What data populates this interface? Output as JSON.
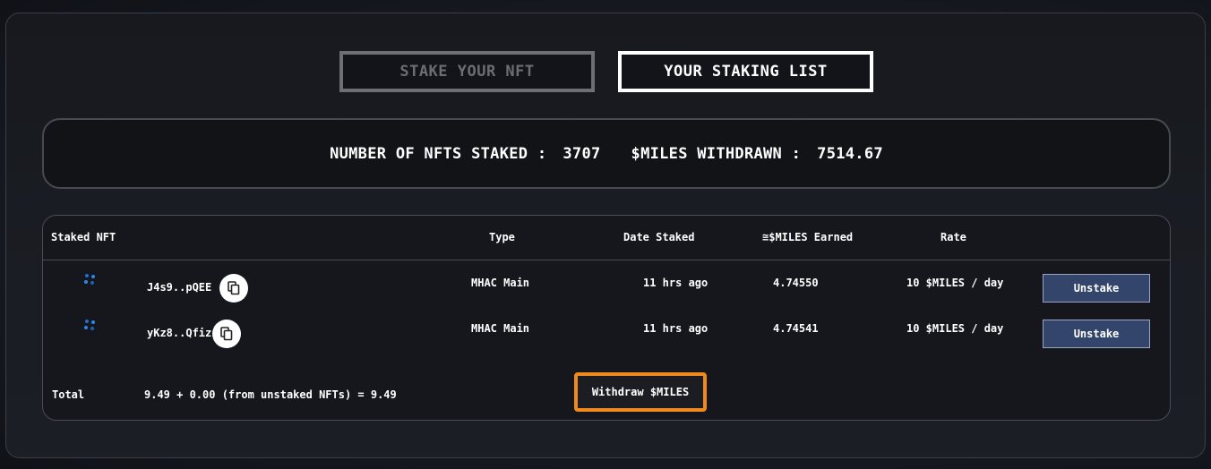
{
  "tabs": {
    "stake_label": "STAKE YOUR NFT",
    "list_label": "YOUR STAKING LIST"
  },
  "stats": {
    "nfts_staked_label": "NUMBER OF NFTS STAKED :",
    "nfts_staked_value": "3707",
    "withdrawn_label": "$MILES WITHDRAWN :",
    "withdrawn_value": "7514.67"
  },
  "table": {
    "headers": {
      "nft": "Staked NFT",
      "type": "Type",
      "date": "Date Staked",
      "earned": "≅$MILES Earned",
      "rate": "Rate"
    },
    "rows": [
      {
        "nft_id": "J4s9..pQEE",
        "type": "MHAC Main",
        "date": "11 hrs ago",
        "earned": "4.74550",
        "rate": "10 $MILES / day",
        "action": "Unstake"
      },
      {
        "nft_id": "yKz8..Qfiz",
        "type": "MHAC Main",
        "date": "11 hrs ago",
        "earned": "4.74541",
        "rate": "10 $MILES / day",
        "action": "Unstake"
      }
    ],
    "total_label": "Total",
    "total_value": "9.49 + 0.00 (from unstaked NFTs) = 9.49",
    "withdraw_label": "Withdraw $MILES"
  },
  "colors": {
    "accent_orange": "#f08a1c",
    "unstake_blue": "#34456b",
    "nft_icon_blue": "#1f6fd6"
  },
  "icons": {
    "nft": "nft-dots-icon",
    "copy": "copy-icon"
  }
}
